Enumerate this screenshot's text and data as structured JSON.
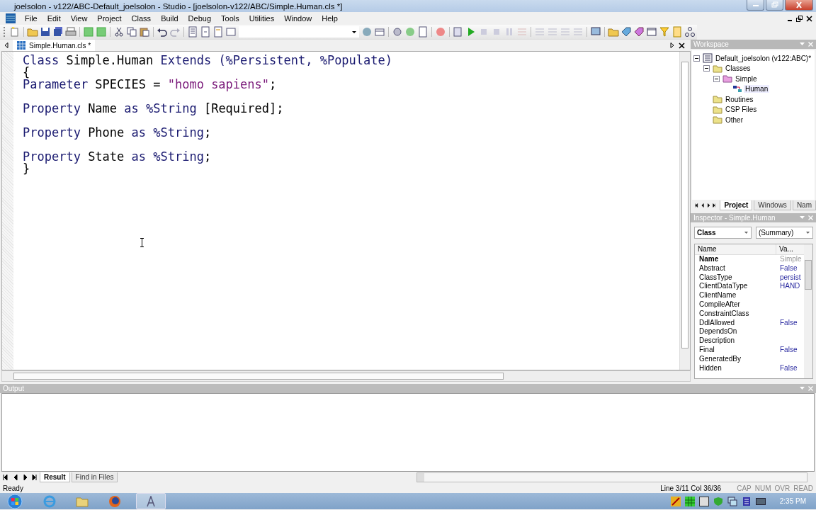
{
  "window": {
    "title": "joelsolon - v122/ABC-Default_joelsolon - Studio - [joelsolon-v122/ABC/Simple.Human.cls *]"
  },
  "menu": [
    "File",
    "Edit",
    "View",
    "Project",
    "Class",
    "Build",
    "Debug",
    "Tools",
    "Utilities",
    "Window",
    "Help"
  ],
  "editor_tabs": [
    {
      "label": "Simple.Human.cls *",
      "selected": true
    }
  ],
  "code_lines": [
    {
      "gap_before": false,
      "tokens": [
        {
          "text": "Class",
          "kind": "keyword"
        },
        {
          "text": " Simple.Human ",
          "kind": "plain"
        },
        {
          "text": "Extends",
          "kind": "keyword"
        },
        {
          "text": " (%Persistent, %Populate)",
          "kind": "keyword"
        }
      ]
    },
    {
      "gap_before": false,
      "tokens": [
        {
          "text": "{",
          "kind": "plain"
        }
      ]
    },
    {
      "gap_before": false,
      "tokens": [
        {
          "text": "Parameter",
          "kind": "keyword"
        },
        {
          "text": " SPECIES = ",
          "kind": "plain"
        },
        {
          "text": "\"homo sapiens\"",
          "kind": "string"
        },
        {
          "text": ";",
          "kind": "plain"
        }
      ]
    },
    {
      "gap_before": true,
      "tokens": [
        {
          "text": "Property",
          "kind": "keyword"
        },
        {
          "text": " Name ",
          "kind": "plain"
        },
        {
          "text": "as %String",
          "kind": "keyword"
        },
        {
          "text": " [Required];",
          "kind": "plain"
        }
      ]
    },
    {
      "gap_before": true,
      "tokens": [
        {
          "text": "Property",
          "kind": "keyword"
        },
        {
          "text": " Phone ",
          "kind": "plain"
        },
        {
          "text": "as %String",
          "kind": "keyword"
        },
        {
          "text": ";",
          "kind": "plain"
        }
      ]
    },
    {
      "gap_before": true,
      "tokens": [
        {
          "text": "Property",
          "kind": "keyword"
        },
        {
          "text": " State ",
          "kind": "plain"
        },
        {
          "text": "as %String",
          "kind": "keyword"
        },
        {
          "text": ";",
          "kind": "plain"
        }
      ]
    },
    {
      "gap_before": false,
      "tokens": [
        {
          "text": "}",
          "kind": "plain"
        }
      ]
    }
  ],
  "workspace": {
    "title": "Workspace",
    "tree": [
      {
        "label": "Default_joelsolon  (v122:ABC)*",
        "kind": "project",
        "expanded": true,
        "children": [
          {
            "label": "Classes",
            "kind": "folder",
            "expanded": true,
            "children": [
              {
                "label": "Simple",
                "kind": "package",
                "expanded": true,
                "children": [
                  {
                    "label": "Human",
                    "kind": "class",
                    "selected": true
                  }
                ]
              }
            ]
          },
          {
            "label": "Routines",
            "kind": "folder"
          },
          {
            "label": "CSP Files",
            "kind": "folder"
          },
          {
            "label": "Other",
            "kind": "folder"
          }
        ]
      }
    ],
    "tabs": [
      {
        "label": "Project",
        "selected": true
      },
      {
        "label": "Windows",
        "selected": false
      },
      {
        "label": "Nam",
        "selected": false
      }
    ]
  },
  "inspector": {
    "title": "Inspector - Simple.Human",
    "category": "Class",
    "view": "(Summary)",
    "columns": [
      "Name",
      "Va..."
    ],
    "rows": [
      {
        "name": "Name",
        "value": "Simple",
        "bold": true,
        "kind": "inherited"
      },
      {
        "name": "Abstract",
        "value": "False",
        "bold": false,
        "kind": "set"
      },
      {
        "name": "ClassType",
        "value": "persist",
        "bold": false,
        "kind": "set"
      },
      {
        "name": "ClientDataType",
        "value": "HAND",
        "bold": false,
        "kind": "set"
      },
      {
        "name": "ClientName",
        "bold": false
      },
      {
        "name": "CompileAfter",
        "bold": false
      },
      {
        "name": "ConstraintClass",
        "bold": false
      },
      {
        "name": "DdlAllowed",
        "value": "False",
        "bold": false,
        "kind": "set"
      },
      {
        "name": "DependsOn",
        "bold": false
      },
      {
        "name": "Description",
        "bold": false
      },
      {
        "name": "Final",
        "value": "False",
        "bold": false,
        "kind": "set"
      },
      {
        "name": "GeneratedBy",
        "bold": false
      },
      {
        "name": "Hidden",
        "value": "False",
        "bold": false,
        "kind": "set"
      }
    ]
  },
  "output": {
    "title": "Output",
    "tabs": [
      {
        "label": "Result",
        "selected": true
      },
      {
        "label": "Find in Files",
        "selected": false
      }
    ]
  },
  "status_bar": {
    "message": "Ready",
    "position": "Line 3/11 Col 36/36",
    "indicators": [
      "CAP",
      "NUM",
      "OVR",
      "READ"
    ]
  },
  "taskbar": {
    "clock": "2:35 PM"
  }
}
